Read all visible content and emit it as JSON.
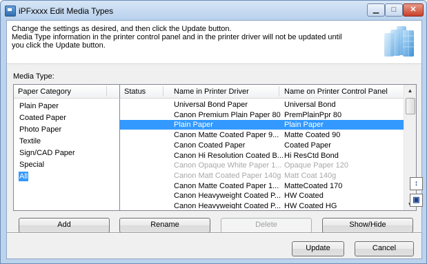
{
  "window": {
    "title": "iPFxxxx Edit Media Types",
    "minimize_label": "▁",
    "maximize_label": "□",
    "close_label": "✕"
  },
  "header": {
    "line1": "Change the settings as desired, and then click the Update button.",
    "line2": "Media Type information in the printer control panel and in the printer driver will not be updated until",
    "line3": "you click the Update button."
  },
  "media_type_label": "Media Type:",
  "category": {
    "header": "Paper Category",
    "items": [
      "Plain Paper",
      "Coated Paper",
      "Photo Paper",
      "Textile",
      "Sign/CAD Paper",
      "Special",
      "All"
    ],
    "selected": "All"
  },
  "table": {
    "columns": [
      "Status",
      "Name in Printer Driver",
      "Name on Printer Control Panel"
    ],
    "rows": [
      {
        "status": "",
        "driver": "Universal Bond Paper",
        "panel": "Universal Bond",
        "state": "normal"
      },
      {
        "status": "",
        "driver": "Canon Premium Plain Paper 80",
        "panel": "PremPlainPpr 80",
        "state": "normal"
      },
      {
        "status": "",
        "driver": "Plain Paper",
        "panel": "Plain Paper",
        "state": "selected"
      },
      {
        "status": "",
        "driver": "Canon Matte Coated Paper 9...",
        "panel": "Matte Coated 90",
        "state": "normal"
      },
      {
        "status": "",
        "driver": "Canon Coated Paper",
        "panel": "Coated Paper",
        "state": "normal"
      },
      {
        "status": "",
        "driver": "Canon Hi Resolution Coated B...",
        "panel": "Hi ResCtd Bond",
        "state": "normal"
      },
      {
        "status": "",
        "driver": "Canon Opaque White Paper 1...",
        "panel": "Opaque Paper 120",
        "state": "dim"
      },
      {
        "status": "",
        "driver": "Canon Matt Coated Paper 140g",
        "panel": "Matt Coat 140g",
        "state": "dim"
      },
      {
        "status": "",
        "driver": "Canon Matte Coated Paper 1...",
        "panel": "MatteCoated 170",
        "state": "normal"
      },
      {
        "status": "",
        "driver": "Canon Heavyweight Coated P...",
        "panel": "HW Coated",
        "state": "normal"
      },
      {
        "status": "",
        "driver": "Canon Heavyweight Coated P...",
        "panel": "HW Coated HG",
        "state": "normal"
      }
    ]
  },
  "side_buttons": {
    "move_up_icon": "sort-icon",
    "move_down_icon": "page-icon"
  },
  "buttons": {
    "add": "Add",
    "rename": "Rename",
    "delete": "Delete",
    "show_hide": "Show/Hide",
    "update": "Update",
    "cancel": "Cancel"
  },
  "colors": {
    "selection": "#3399ff",
    "title_bar": "#bcd3ee",
    "close_button": "#c8402a"
  }
}
